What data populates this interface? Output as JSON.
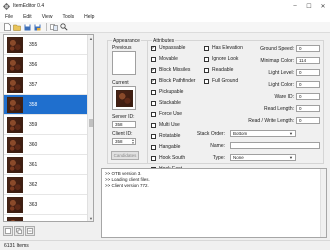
{
  "window": {
    "title": "ItemEditor 0.4",
    "minimize": "–",
    "maximize": "☐",
    "close": "✕"
  },
  "menu": [
    "File",
    "Edit",
    "View",
    "Tools",
    "Help"
  ],
  "items": [
    {
      "id": "355",
      "selected": false
    },
    {
      "id": "356",
      "selected": false
    },
    {
      "id": "357",
      "selected": false
    },
    {
      "id": "358",
      "selected": true
    },
    {
      "id": "359",
      "selected": false
    },
    {
      "id": "360",
      "selected": false
    },
    {
      "id": "361",
      "selected": false
    },
    {
      "id": "362",
      "selected": false
    },
    {
      "id": "363",
      "selected": false
    },
    {
      "id": "364",
      "selected": false
    }
  ],
  "appearance": {
    "title": "Appearance",
    "previous_label": "Previous",
    "current_label": "Current",
    "server_id_label": "Server ID:",
    "server_id": "358",
    "client_id_label": "Client ID:",
    "client_id": "358",
    "candidates_label": "Candidates"
  },
  "attributes": {
    "title": "Attributes",
    "col1": [
      {
        "label": "Unpassable",
        "checked": true
      },
      {
        "label": "Movable",
        "checked": false
      },
      {
        "label": "Block Missiles",
        "checked": true
      },
      {
        "label": "Block Pathfinder",
        "checked": true
      },
      {
        "label": "Pickupable",
        "checked": false
      },
      {
        "label": "Stackable",
        "checked": false
      },
      {
        "label": "Force Use",
        "checked": false
      },
      {
        "label": "Multi Use",
        "checked": false
      },
      {
        "label": "Rotatable",
        "checked": false
      },
      {
        "label": "Hangable",
        "checked": false
      },
      {
        "label": "Hook South",
        "checked": false
      },
      {
        "label": "Hook East",
        "checked": false
      }
    ],
    "col2": [
      {
        "label": "Has Elevation",
        "checked": false
      },
      {
        "label": "Ignore Look",
        "checked": false
      },
      {
        "label": "Readable",
        "checked": false
      },
      {
        "label": "Full Ground",
        "checked": false
      }
    ],
    "fields": [
      {
        "label": "Ground Speed:",
        "value": "0"
      },
      {
        "label": "Minimap Color:",
        "value": "114"
      },
      {
        "label": "Light Level:",
        "value": "0"
      },
      {
        "label": "Light Color:",
        "value": "0"
      },
      {
        "label": "Ware ID:",
        "value": "0"
      },
      {
        "label": "Read Length:",
        "value": "0"
      },
      {
        "label": "Read / Write Length:",
        "value": "0"
      }
    ],
    "stack_order_label": "Stack Order:",
    "stack_order_value": "Bottom",
    "name_label": "Name:",
    "name_value": "",
    "type_label": "Type:",
    "type_value": "None"
  },
  "log": [
    ">> OTB version 3.",
    ">> Loading client files.",
    ">> Client version 772."
  ],
  "status": {
    "count": "6131 Items"
  },
  "icons": [
    "app-icon",
    "new-icon",
    "open-icon",
    "save-icon",
    "save-as-icon",
    "compare-icon",
    "find-icon",
    "add-icon",
    "duplicate-icon",
    "remove-icon"
  ]
}
